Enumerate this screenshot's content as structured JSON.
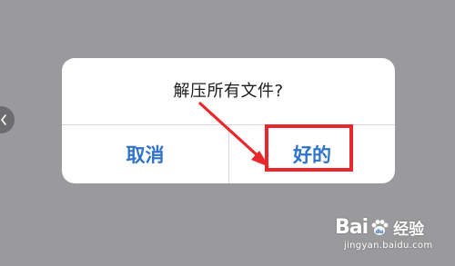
{
  "dialog": {
    "title": "解压所有文件?",
    "cancel_label": "取消",
    "ok_label": "好的"
  },
  "watermark": {
    "brand_left": "Bai",
    "brand_right": "经验",
    "url": "jingyan.baidu.com"
  },
  "colors": {
    "overlay": "#9a999b",
    "button_text": "#2e73c9",
    "highlight": "#e8282a"
  },
  "icons": {
    "back": "chevron-left-icon",
    "annotation": "arrow-icon",
    "brand": "paw-icon"
  }
}
